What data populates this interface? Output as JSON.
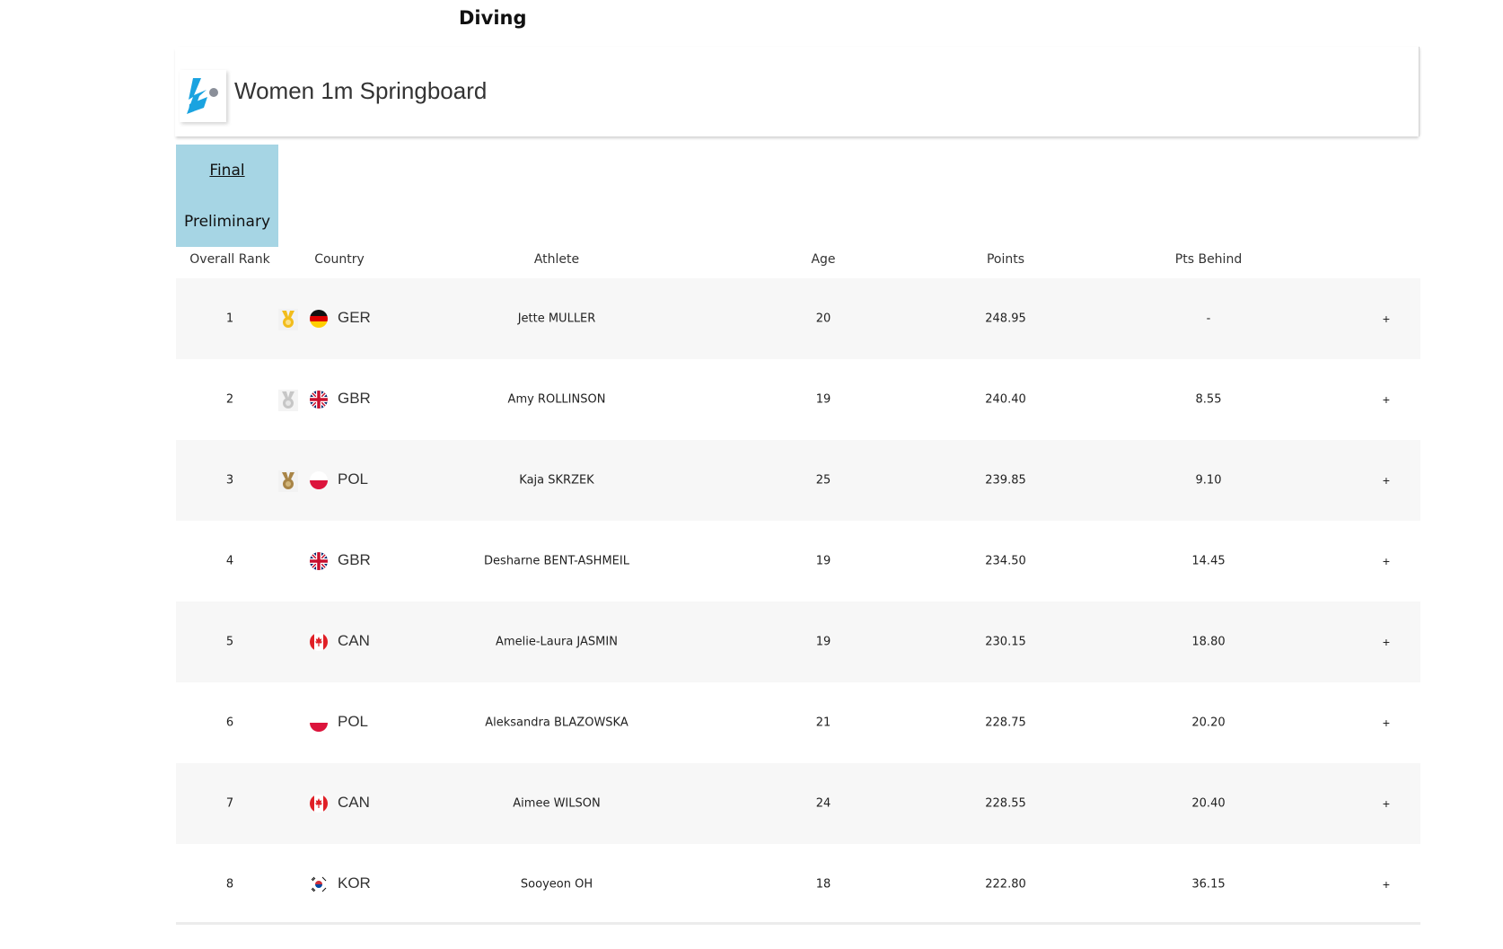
{
  "sport": "Diving",
  "event": {
    "title": "Women 1m Springboard"
  },
  "tabs": [
    {
      "label": "Final"
    },
    {
      "label": "Preliminary"
    }
  ],
  "columns": {
    "rank": "Overall Rank",
    "country": "Country",
    "athlete": "Athlete",
    "age": "Age",
    "points": "Points",
    "behind": "Pts Behind"
  },
  "rows": [
    {
      "rank": "1",
      "medal": "gold-medal-icon",
      "flag": "germany-flag-icon",
      "country": "GER",
      "athlete": "Jette MULLER",
      "age": "20",
      "points": "248.95",
      "behind": "-",
      "expand": "+"
    },
    {
      "rank": "2",
      "medal": "silver-medal-icon",
      "flag": "uk-flag-icon",
      "country": "GBR",
      "athlete": "Amy ROLLINSON",
      "age": "19",
      "points": "240.40",
      "behind": "8.55",
      "expand": "+"
    },
    {
      "rank": "3",
      "medal": "bronze-medal-icon",
      "flag": "poland-flag-icon",
      "country": "POL",
      "athlete": "Kaja SKRZEK",
      "age": "25",
      "points": "239.85",
      "behind": "9.10",
      "expand": "+"
    },
    {
      "rank": "4",
      "medal": "",
      "flag": "uk-flag-icon",
      "country": "GBR",
      "athlete": "Desharne BENT-ASHMEIL",
      "age": "19",
      "points": "234.50",
      "behind": "14.45",
      "expand": "+"
    },
    {
      "rank": "5",
      "medal": "",
      "flag": "canada-flag-icon",
      "country": "CAN",
      "athlete": "Amelie-Laura JASMIN",
      "age": "19",
      "points": "230.15",
      "behind": "18.80",
      "expand": "+"
    },
    {
      "rank": "6",
      "medal": "",
      "flag": "poland-flag-icon",
      "country": "POL",
      "athlete": "Aleksandra BLAZOWSKA",
      "age": "21",
      "points": "228.75",
      "behind": "20.20",
      "expand": "+"
    },
    {
      "rank": "7",
      "medal": "",
      "flag": "canada-flag-icon",
      "country": "CAN",
      "athlete": "Aimee WILSON",
      "age": "24",
      "points": "228.55",
      "behind": "20.40",
      "expand": "+"
    },
    {
      "rank": "8",
      "medal": "",
      "flag": "south-korea-flag-icon",
      "country": "KOR",
      "athlete": "Sooyeon OH",
      "age": "18",
      "points": "222.80",
      "behind": "36.15",
      "expand": "+"
    }
  ],
  "colors": {
    "tab_background": "#a6d5e4",
    "row_stripe": "#f7f7f7",
    "logo_blue": "#1aa3e0",
    "gold": "#f2bd1c",
    "silver": "#c6c6c6",
    "bronze": "#a88446"
  }
}
